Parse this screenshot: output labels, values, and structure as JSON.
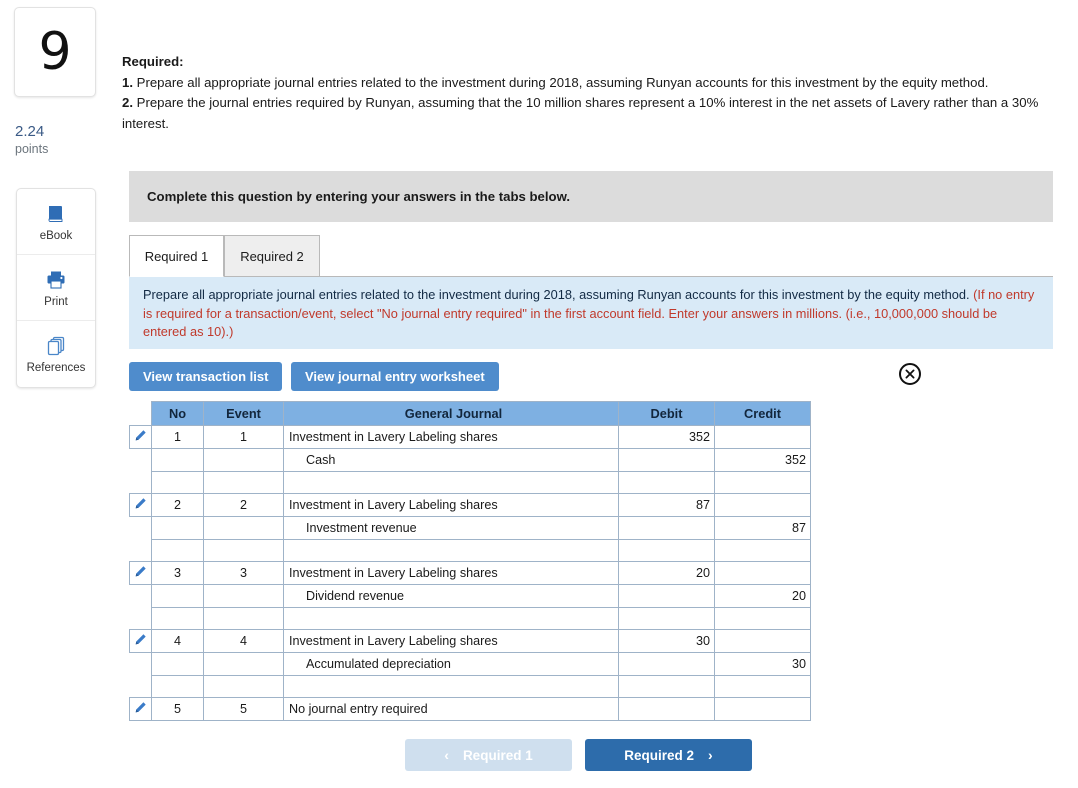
{
  "sidebar": {
    "question_number": "9",
    "points_value": "2.24",
    "points_label": "points",
    "tools": [
      {
        "label": "eBook",
        "icon": "book-icon"
      },
      {
        "label": "Print",
        "icon": "printer-icon"
      },
      {
        "label": "References",
        "icon": "copy-pages-icon"
      }
    ]
  },
  "required": {
    "heading": "Required:",
    "item1_num": "1.",
    "item1_text": " Prepare all appropriate journal entries related to the investment during 2018, assuming Runyan accounts for this investment by the equity method.",
    "item2_num": "2.",
    "item2_text": " Prepare the journal entries required by Runyan, assuming that the 10 million shares represent a 10% interest in the net assets of Lavery rather than a 30% interest."
  },
  "banner": {
    "text": "Complete this question by entering your answers in the tabs below."
  },
  "tabs": [
    {
      "label": "Required 1",
      "active": true
    },
    {
      "label": "Required 2",
      "active": false
    }
  ],
  "instruction": {
    "black_part": "Prepare all appropriate journal entries related to the investment during 2018, assuming Runyan accounts for this investment by the equity method. ",
    "red_part": "(If no entry is required for a transaction/event, select \"No journal entry required\" in the first account field. Enter your answers in millions. (i.e., 10,000,000 should be entered as 10).)"
  },
  "toolbar": {
    "view_transaction_list": "View transaction list",
    "view_journal_worksheet": "View journal entry worksheet",
    "close_icon": "close-circle-icon"
  },
  "journal": {
    "columns": [
      "No",
      "Event",
      "General Journal",
      "Debit",
      "Credit"
    ],
    "rows": [
      {
        "pencil": true,
        "no": "1",
        "event": "1",
        "account": "Investment in Lavery Labeling shares",
        "indent": false,
        "debit": "352",
        "credit": ""
      },
      {
        "pencil": false,
        "no": "",
        "event": "",
        "account": "Cash",
        "indent": true,
        "debit": "",
        "credit": "352"
      },
      {
        "pencil": false,
        "no": "",
        "event": "",
        "account": "",
        "indent": false,
        "debit": "",
        "credit": ""
      },
      {
        "pencil": true,
        "no": "2",
        "event": "2",
        "account": "Investment in Lavery Labeling shares",
        "indent": false,
        "debit": "87",
        "credit": ""
      },
      {
        "pencil": false,
        "no": "",
        "event": "",
        "account": "Investment revenue",
        "indent": true,
        "debit": "",
        "credit": "87"
      },
      {
        "pencil": false,
        "no": "",
        "event": "",
        "account": "",
        "indent": false,
        "debit": "",
        "credit": ""
      },
      {
        "pencil": true,
        "no": "3",
        "event": "3",
        "account": "Investment in Lavery Labeling shares",
        "indent": false,
        "debit": "20",
        "credit": ""
      },
      {
        "pencil": false,
        "no": "",
        "event": "",
        "account": "Dividend revenue",
        "indent": true,
        "debit": "",
        "credit": "20"
      },
      {
        "pencil": false,
        "no": "",
        "event": "",
        "account": "",
        "indent": false,
        "debit": "",
        "credit": ""
      },
      {
        "pencil": true,
        "no": "4",
        "event": "4",
        "account": "Investment in Lavery Labeling shares",
        "indent": false,
        "debit": "30",
        "credit": ""
      },
      {
        "pencil": false,
        "no": "",
        "event": "",
        "account": "Accumulated depreciation",
        "indent": true,
        "debit": "",
        "credit": "30"
      },
      {
        "pencil": false,
        "no": "",
        "event": "",
        "account": "",
        "indent": false,
        "debit": "",
        "credit": ""
      },
      {
        "pencil": true,
        "no": "5",
        "event": "5",
        "account": "No journal entry required",
        "indent": false,
        "debit": "",
        "credit": ""
      }
    ]
  },
  "footer": {
    "prev_label": "Required 1",
    "prev_chevron": "‹",
    "next_label": "Required 2",
    "next_chevron": "›"
  },
  "colors": {
    "table_header": "#7eb0e2",
    "button_blue": "#4f8ccc",
    "next_blue": "#2d6cab",
    "prev_blue": "#cfdfee",
    "panel_blue": "#d9eaf7",
    "banner_gray": "#dcdcdc",
    "red_text": "#c0392b",
    "points_blue": "#3a5a86"
  }
}
